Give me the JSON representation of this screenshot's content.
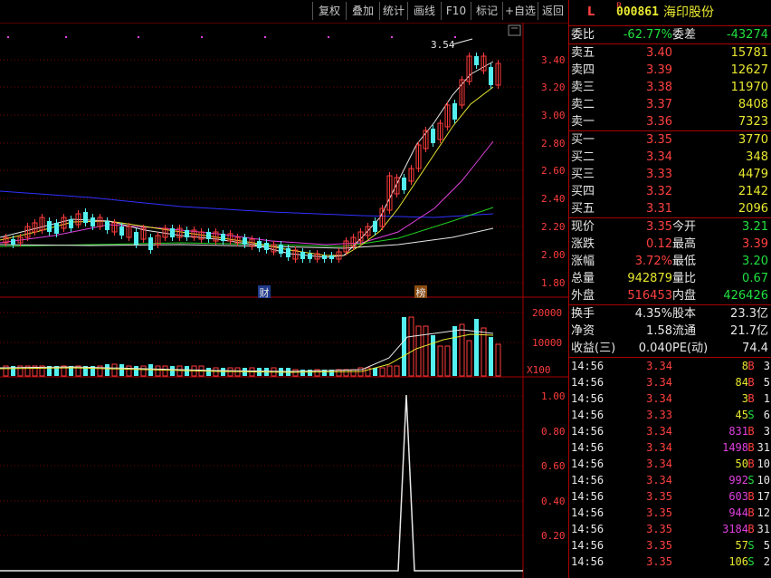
{
  "toolbar": {
    "buttons": [
      "复权",
      "叠加",
      "统计",
      "画线",
      "F10",
      "标记",
      "+自选",
      "返回"
    ]
  },
  "chart": {
    "price_axis": [
      "3.40",
      "3.20",
      "3.00",
      "2.80",
      "2.60",
      "2.40",
      "2.20",
      "2.00",
      "1.80"
    ],
    "volume_axis": [
      "20000",
      "10000"
    ],
    "volume_unit": "X100",
    "indicator_axis": [
      "1.00",
      "0.80",
      "0.60",
      "0.40",
      "0.20"
    ],
    "high_label": "3.54",
    "marker_cai": "财",
    "marker_bang": "榜"
  },
  "stock": {
    "flag": "L",
    "badge": "R",
    "code": "000861",
    "name": "海印股份"
  },
  "weibi": {
    "label": "委比",
    "value": "-62.77%",
    "label2": "委差",
    "value2": "-43274"
  },
  "asks": [
    {
      "label": "卖五",
      "price": "3.40",
      "vol": "15781"
    },
    {
      "label": "卖四",
      "price": "3.39",
      "vol": "12627"
    },
    {
      "label": "卖三",
      "price": "3.38",
      "vol": "11970"
    },
    {
      "label": "卖二",
      "price": "3.37",
      "vol": "8408"
    },
    {
      "label": "卖一",
      "price": "3.36",
      "vol": "7323"
    }
  ],
  "bids": [
    {
      "label": "买一",
      "price": "3.35",
      "vol": "3770"
    },
    {
      "label": "买二",
      "price": "3.34",
      "vol": "348"
    },
    {
      "label": "买三",
      "price": "3.33",
      "vol": "4479"
    },
    {
      "label": "买四",
      "price": "3.32",
      "vol": "2142"
    },
    {
      "label": "买五",
      "price": "3.31",
      "vol": "2096"
    }
  ],
  "stats": [
    {
      "l1": "现价",
      "v1": "3.35",
      "c1": "red",
      "l2": "今开",
      "v2": "3.21",
      "c2": "grn"
    },
    {
      "l1": "涨跌",
      "v1": "0.12",
      "c1": "red",
      "l2": "最高",
      "v2": "3.39",
      "c2": "red"
    },
    {
      "l1": "涨幅",
      "v1": "3.72%",
      "c1": "red",
      "l2": "最低",
      "v2": "3.20",
      "c2": "grn"
    },
    {
      "l1": "总量",
      "v1": "942879",
      "c1": "yel",
      "l2": "量比",
      "v2": "0.67",
      "c2": "grn"
    },
    {
      "l1": "外盘",
      "v1": "516453",
      "c1": "red",
      "l2": "内盘",
      "v2": "426426",
      "c2": "grn"
    }
  ],
  "stats2": [
    {
      "l1": "换手",
      "v1": "4.35%",
      "l2": "股本",
      "v2": "23.3亿"
    },
    {
      "l1": "净资",
      "v1": "1.58",
      "l2": "流通",
      "v2": "21.7亿"
    },
    {
      "l1": "收益(三)",
      "v1": "0.040",
      "l2": "PE(动)",
      "v2": "74.4"
    }
  ],
  "ticks": [
    {
      "t": "14:56",
      "p": "3.34",
      "v": "8",
      "bs": "B",
      "n": "3"
    },
    {
      "t": "14:56",
      "p": "3.34",
      "v": "84",
      "bs": "B",
      "n": "5"
    },
    {
      "t": "14:56",
      "p": "3.34",
      "v": "3",
      "bs": "B",
      "n": "1"
    },
    {
      "t": "14:56",
      "p": "3.33",
      "v": "45",
      "bs": "S",
      "n": "6"
    },
    {
      "t": "14:56",
      "p": "3.34",
      "v": "831",
      "bs": "B",
      "n": "3"
    },
    {
      "t": "14:56",
      "p": "3.34",
      "v": "1498",
      "bs": "B",
      "n": "31"
    },
    {
      "t": "14:56",
      "p": "3.34",
      "v": "50",
      "bs": "B",
      "n": "10"
    },
    {
      "t": "14:56",
      "p": "3.34",
      "v": "992",
      "bs": "S",
      "n": "10"
    },
    {
      "t": "14:56",
      "p": "3.35",
      "v": "603",
      "bs": "B",
      "n": "17"
    },
    {
      "t": "14:56",
      "p": "3.35",
      "v": "944",
      "bs": "B",
      "n": "12"
    },
    {
      "t": "14:56",
      "p": "3.35",
      "v": "3184",
      "bs": "B",
      "n": "31"
    },
    {
      "t": "14:56",
      "p": "3.35",
      "v": "57",
      "bs": "S",
      "n": "5"
    },
    {
      "t": "14:56",
      "p": "3.35",
      "v": "106",
      "bs": "S",
      "n": "2"
    }
  ]
}
